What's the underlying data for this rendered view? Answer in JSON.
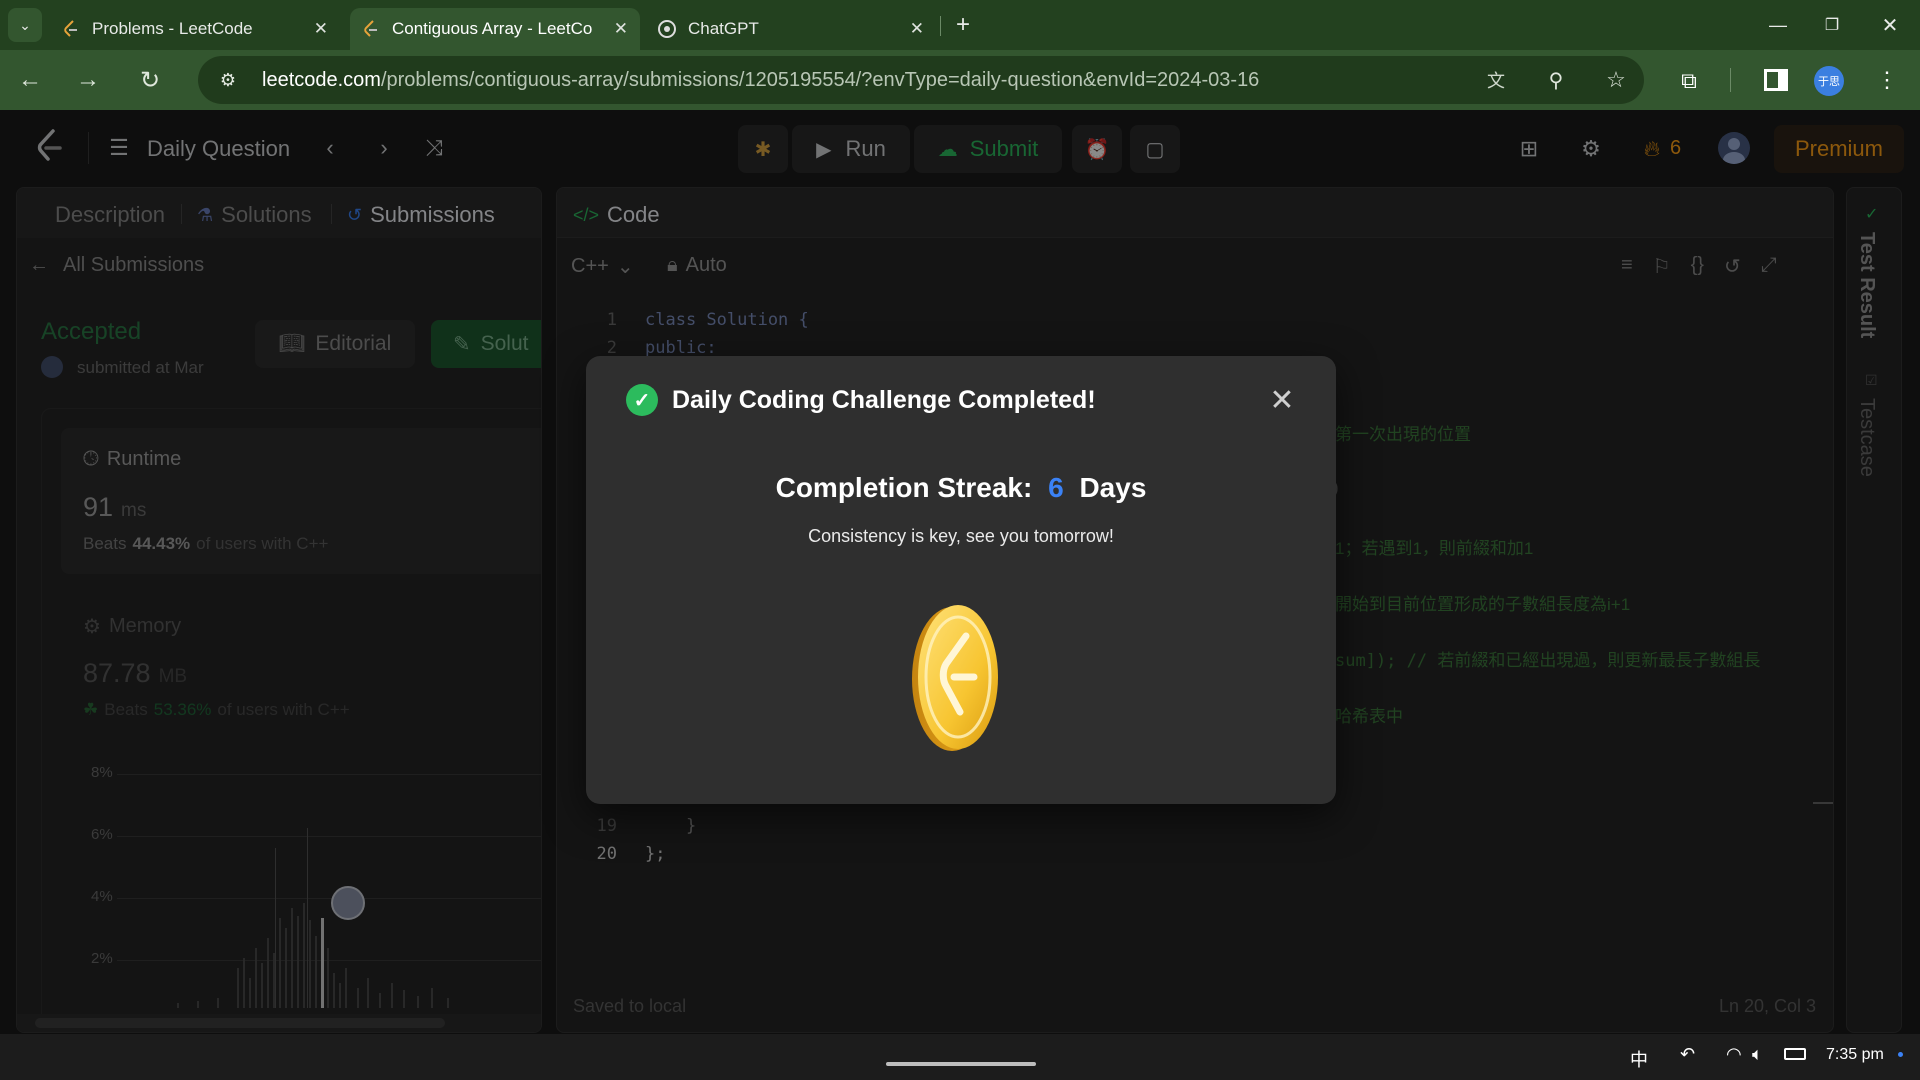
{
  "browser": {
    "tabs": [
      {
        "title": "Problems - LeetCode",
        "active": false
      },
      {
        "title": "Contiguous Array - LeetCo",
        "active": true
      },
      {
        "title": "ChatGPT",
        "active": false
      }
    ],
    "url_host": "leetcode.com",
    "url_path": "/problems/contiguous-array/submissions/1205195554/?envType=daily-question&envId=2024-03-16",
    "profile_label": "于思"
  },
  "nav": {
    "daily_question": "Daily Question",
    "run": "Run",
    "submit": "Submit",
    "streak_count": "6",
    "premium": "Premium"
  },
  "left": {
    "tabs": [
      "Description",
      "Solutions",
      "Submissions"
    ],
    "all_submissions": "All Submissions",
    "status": "Accepted",
    "submitted": "submitted at Mar",
    "editorial": "Editorial",
    "solution": "Solut",
    "runtime_label": "Runtime",
    "runtime_value": "91",
    "runtime_unit": "ms",
    "runtime_beats_pre": "Beats",
    "runtime_beats": "44.43%",
    "runtime_beats_post": "of users with C++",
    "memory_label": "Memory",
    "memory_value": "87.78",
    "memory_unit": "MB",
    "memory_beats_pre": "Beats",
    "memory_beats": "53.36%",
    "memory_beats_post": "of users with C++",
    "y_ticks": [
      "8%",
      "6%",
      "4%",
      "2%"
    ]
  },
  "code": {
    "header": "Code",
    "language": "C++",
    "auto": "Auto",
    "lines": [
      {
        "n": "1",
        "t": "class Solution {"
      },
      {
        "n": "2",
        "t": "public:"
      },
      {
        "n": "19",
        "t": "    }"
      },
      {
        "n": "20",
        "t": "};"
      }
    ],
    "comment_fragments": [
      "第一次出現的位置",
      "1；若遇到1，則前綴和加1",
      "開始到目前位置形成的子數組長度為i+1",
      "sum]); // 若前綴和已經出現過，則更新最長子數組長",
      "哈希表中"
    ],
    "saved": "Saved to local",
    "position": "Ln 20, Col 3"
  },
  "side": {
    "test_result": "Test Result",
    "testcase": "Testcase"
  },
  "modal": {
    "title": "Daily Coding Challenge Completed!",
    "streak_label": "Completion Streak:",
    "streak_value": "6",
    "streak_unit": "Days",
    "message": "Consistency is key, see you tomorrow!"
  },
  "taskbar": {
    "ime": "中",
    "time": "7:35 pm"
  },
  "colors": {
    "accent_green": "#2cbb5d",
    "streak_blue": "#3b82f6",
    "premium_orange": "#ffa116"
  }
}
